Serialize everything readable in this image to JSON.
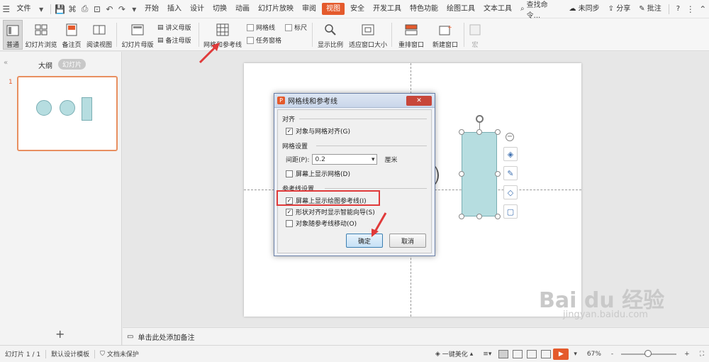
{
  "menubar": {
    "file_label": "文件",
    "items": [
      "开始",
      "插入",
      "设计",
      "切换",
      "动画",
      "幻灯片放映",
      "审阅",
      "视图",
      "安全",
      "开发工具",
      "特色功能",
      "绘图工具",
      "文本工具"
    ],
    "active_item": "视图",
    "search_label": "查找命令...",
    "sync_label": "未同步",
    "share_label": "分享",
    "comment_label": "批注",
    "help_label": "?"
  },
  "ribbon": {
    "normal": "普通",
    "slide_sorter": "幻灯片浏览",
    "notes_page": "备注页",
    "reading_view": "阅读视图",
    "slide_master": "幻灯片母版",
    "handout_master": "讲义母版",
    "notes_master": "备注母版",
    "grid_guides": "网格和参考线",
    "gridlines": "网格线",
    "ruler": "标尺",
    "task_pane": "任务窗格",
    "zoom": "显示比例",
    "fit_window": "适应窗口大小",
    "arrange_window": "重排窗口",
    "new_window": "新建窗口",
    "macro": "宏"
  },
  "left_panel": {
    "tab_outline": "大纲",
    "tab_slides": "幻灯片",
    "slide_number": "1",
    "add_label": "+"
  },
  "notes_bar": {
    "placeholder": "单击此处添加备注"
  },
  "status": {
    "slide_info": "幻灯片 1 / 1",
    "template": "默认设计模板",
    "protection": "文档未保护",
    "beautify": "一键美化",
    "zoom": "67%",
    "minus": "-",
    "plus": "+"
  },
  "dialog": {
    "title": "网格线和参考线",
    "section_align": "对齐",
    "snap_to_grid": "对象与网格对齐(G)",
    "section_grid": "网格设置",
    "spacing_label": "间距(P):",
    "spacing_value": "0.2",
    "spacing_unit": "厘米",
    "show_grid": "屏幕上显示网格(D)",
    "section_guides": "参考线设置",
    "show_guides": "屏幕上显示绘图参考线(I)",
    "smart_guides": "形状对齐时显示智能向导(S)",
    "move_with_guides": "对象随参考线移动(O)",
    "ok": "确定",
    "cancel": "取消",
    "snap_checked": true,
    "show_grid_checked": false,
    "show_guides_checked": true,
    "smart_guides_checked": true,
    "move_with_guides_checked": false
  },
  "watermark": {
    "brand": "Bai du 经验",
    "url": "jingyan.baidu.com"
  }
}
